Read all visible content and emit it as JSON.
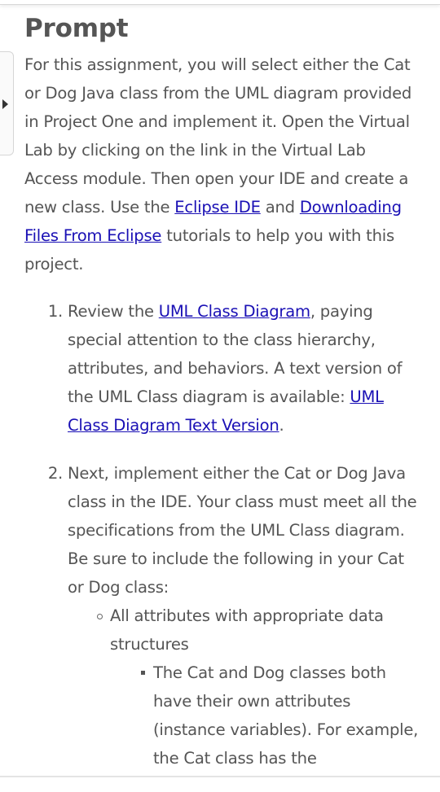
{
  "page": {
    "title": "Prompt"
  },
  "intro": {
    "text_1": "For this assignment, you will select either the Cat or Dog Java class from the UML diagram provided in Project One and implement it. Open the Virtual Lab by clicking on the link in the Virtual Lab Access module. Then open your IDE and create a new class. Use the ",
    "link_eclipse_ide": "Eclipse IDE",
    "text_2": " and ",
    "link_downloading": "Downloading Files From Eclipse",
    "text_3": " tutorials to help you with this project."
  },
  "steps": [
    {
      "text_1": "Review the ",
      "link": "UML Class Diagram",
      "text_2": ", paying special attention to the class hierarchy, attributes, and behaviors. A text version of the UML Class diagram is available: ",
      "link_2": "UML Class Diagram Text Version",
      "text_3": "."
    },
    {
      "text_1": "Next, implement either the Cat or Dog Java class in the IDE. Your class must meet all the specifications from the UML Class diagram. Be sure to include the following in your Cat or Dog class:",
      "sub_items": [
        {
          "text": "All attributes with appropriate data structures",
          "sub_items": [
            {
              "text": "The Cat and Dog classes both have their own attributes (instance variables). For example, the Cat class has the"
            }
          ]
        }
      ]
    }
  ],
  "colors": {
    "text": "#555555",
    "link": "#1a10b5"
  },
  "icons": {
    "side_toggle": "caret-right-icon"
  }
}
